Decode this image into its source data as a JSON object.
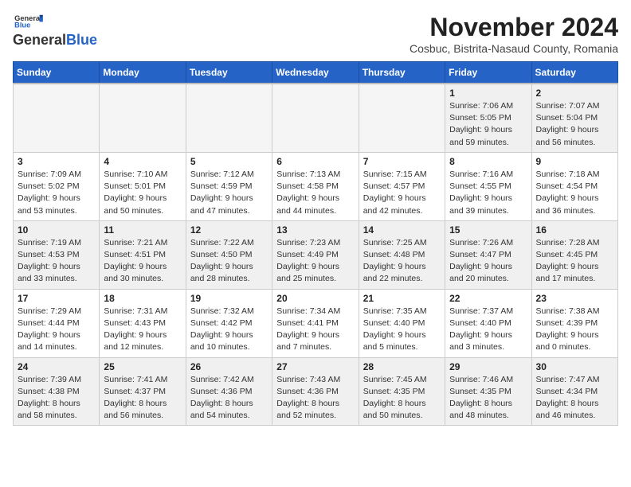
{
  "header": {
    "logo_general": "General",
    "logo_blue": "Blue",
    "month_title": "November 2024",
    "subtitle": "Cosbuc, Bistrita-Nasaud County, Romania"
  },
  "days_of_week": [
    "Sunday",
    "Monday",
    "Tuesday",
    "Wednesday",
    "Thursday",
    "Friday",
    "Saturday"
  ],
  "weeks": [
    {
      "days": [
        {
          "num": "",
          "info": "",
          "empty": true
        },
        {
          "num": "",
          "info": "",
          "empty": true
        },
        {
          "num": "",
          "info": "",
          "empty": true
        },
        {
          "num": "",
          "info": "",
          "empty": true
        },
        {
          "num": "",
          "info": "",
          "empty": true
        },
        {
          "num": "1",
          "info": "Sunrise: 7:06 AM\nSunset: 5:05 PM\nDaylight: 9 hours and 59 minutes."
        },
        {
          "num": "2",
          "info": "Sunrise: 7:07 AM\nSunset: 5:04 PM\nDaylight: 9 hours and 56 minutes."
        }
      ]
    },
    {
      "days": [
        {
          "num": "3",
          "info": "Sunrise: 7:09 AM\nSunset: 5:02 PM\nDaylight: 9 hours and 53 minutes."
        },
        {
          "num": "4",
          "info": "Sunrise: 7:10 AM\nSunset: 5:01 PM\nDaylight: 9 hours and 50 minutes."
        },
        {
          "num": "5",
          "info": "Sunrise: 7:12 AM\nSunset: 4:59 PM\nDaylight: 9 hours and 47 minutes."
        },
        {
          "num": "6",
          "info": "Sunrise: 7:13 AM\nSunset: 4:58 PM\nDaylight: 9 hours and 44 minutes."
        },
        {
          "num": "7",
          "info": "Sunrise: 7:15 AM\nSunset: 4:57 PM\nDaylight: 9 hours and 42 minutes."
        },
        {
          "num": "8",
          "info": "Sunrise: 7:16 AM\nSunset: 4:55 PM\nDaylight: 9 hours and 39 minutes."
        },
        {
          "num": "9",
          "info": "Sunrise: 7:18 AM\nSunset: 4:54 PM\nDaylight: 9 hours and 36 minutes."
        }
      ]
    },
    {
      "days": [
        {
          "num": "10",
          "info": "Sunrise: 7:19 AM\nSunset: 4:53 PM\nDaylight: 9 hours and 33 minutes."
        },
        {
          "num": "11",
          "info": "Sunrise: 7:21 AM\nSunset: 4:51 PM\nDaylight: 9 hours and 30 minutes."
        },
        {
          "num": "12",
          "info": "Sunrise: 7:22 AM\nSunset: 4:50 PM\nDaylight: 9 hours and 28 minutes."
        },
        {
          "num": "13",
          "info": "Sunrise: 7:23 AM\nSunset: 4:49 PM\nDaylight: 9 hours and 25 minutes."
        },
        {
          "num": "14",
          "info": "Sunrise: 7:25 AM\nSunset: 4:48 PM\nDaylight: 9 hours and 22 minutes."
        },
        {
          "num": "15",
          "info": "Sunrise: 7:26 AM\nSunset: 4:47 PM\nDaylight: 9 hours and 20 minutes."
        },
        {
          "num": "16",
          "info": "Sunrise: 7:28 AM\nSunset: 4:45 PM\nDaylight: 9 hours and 17 minutes."
        }
      ]
    },
    {
      "days": [
        {
          "num": "17",
          "info": "Sunrise: 7:29 AM\nSunset: 4:44 PM\nDaylight: 9 hours and 14 minutes."
        },
        {
          "num": "18",
          "info": "Sunrise: 7:31 AM\nSunset: 4:43 PM\nDaylight: 9 hours and 12 minutes."
        },
        {
          "num": "19",
          "info": "Sunrise: 7:32 AM\nSunset: 4:42 PM\nDaylight: 9 hours and 10 minutes."
        },
        {
          "num": "20",
          "info": "Sunrise: 7:34 AM\nSunset: 4:41 PM\nDaylight: 9 hours and 7 minutes."
        },
        {
          "num": "21",
          "info": "Sunrise: 7:35 AM\nSunset: 4:40 PM\nDaylight: 9 hours and 5 minutes."
        },
        {
          "num": "22",
          "info": "Sunrise: 7:37 AM\nSunset: 4:40 PM\nDaylight: 9 hours and 3 minutes."
        },
        {
          "num": "23",
          "info": "Sunrise: 7:38 AM\nSunset: 4:39 PM\nDaylight: 9 hours and 0 minutes."
        }
      ]
    },
    {
      "days": [
        {
          "num": "24",
          "info": "Sunrise: 7:39 AM\nSunset: 4:38 PM\nDaylight: 8 hours and 58 minutes."
        },
        {
          "num": "25",
          "info": "Sunrise: 7:41 AM\nSunset: 4:37 PM\nDaylight: 8 hours and 56 minutes."
        },
        {
          "num": "26",
          "info": "Sunrise: 7:42 AM\nSunset: 4:36 PM\nDaylight: 8 hours and 54 minutes."
        },
        {
          "num": "27",
          "info": "Sunrise: 7:43 AM\nSunset: 4:36 PM\nDaylight: 8 hours and 52 minutes."
        },
        {
          "num": "28",
          "info": "Sunrise: 7:45 AM\nSunset: 4:35 PM\nDaylight: 8 hours and 50 minutes."
        },
        {
          "num": "29",
          "info": "Sunrise: 7:46 AM\nSunset: 4:35 PM\nDaylight: 8 hours and 48 minutes."
        },
        {
          "num": "30",
          "info": "Sunrise: 7:47 AM\nSunset: 4:34 PM\nDaylight: 8 hours and 46 minutes."
        }
      ]
    }
  ]
}
